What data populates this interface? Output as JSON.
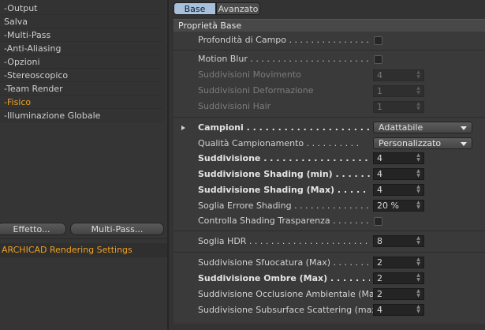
{
  "nav": {
    "items": [
      {
        "label": "Output",
        "prefix": "-",
        "active": false
      },
      {
        "label": "Salva",
        "prefix": "",
        "active": false
      },
      {
        "label": "Multi-Pass",
        "prefix": "-",
        "active": false
      },
      {
        "label": "Anti-Aliasing",
        "prefix": "-",
        "active": false
      },
      {
        "label": "Opzioni",
        "prefix": "-",
        "active": false
      },
      {
        "label": "Stereoscopico",
        "prefix": "-",
        "active": false
      },
      {
        "label": "Team Render",
        "prefix": "-",
        "active": false
      },
      {
        "label": "Fisico",
        "prefix": "-",
        "active": true
      },
      {
        "label": "Illuminazione Globale",
        "prefix": "-",
        "active": false
      }
    ],
    "effect_button": "Effetto...",
    "multipass_button": "Multi-Pass...",
    "renderer_label": "ARCHICAD Rendering Settings"
  },
  "tabs": {
    "base": "Base",
    "advanced": "Avanzato"
  },
  "group_title": "Proprietà Base",
  "rows": {
    "profondita": {
      "label": "Profondità di Campo"
    },
    "motion_blur": {
      "label": "Motion Blur"
    },
    "sudd_movimento": {
      "label": "Suddivisioni Movimento",
      "value": "4"
    },
    "sudd_deformazione": {
      "label": "Suddivisioni Deformazione",
      "value": "1"
    },
    "sudd_hair": {
      "label": "Suddivisioni Hair",
      "value": "1"
    },
    "campioni": {
      "label": "Campioni",
      "value": "Adattabile"
    },
    "qualita": {
      "label": "Qualità Campionamento",
      "value": "Personalizzato"
    },
    "suddivisione": {
      "label": "Suddivisione",
      "value": "4"
    },
    "sudd_shading_min": {
      "label": "Suddivisione Shading (min)",
      "value": "4"
    },
    "sudd_shading_max": {
      "label": "Suddivisione Shading (Max)",
      "value": "4"
    },
    "soglia_errore": {
      "label": "Soglia Errore Shading",
      "value": "20 %"
    },
    "controlla_trasparenza": {
      "label": "Controlla Shading Trasparenza"
    },
    "soglia_hdr": {
      "label": "Soglia HDR",
      "value": "8"
    },
    "sudd_sfuocatura": {
      "label": "Suddivisione Sfuocatura (Max)",
      "value": "2"
    },
    "sudd_ombre": {
      "label": "Suddivisione Ombre (Max)",
      "value": "2"
    },
    "sudd_occlusione": {
      "label": "Suddivisione Occlusione Ambientale (Max)",
      "value": "2"
    },
    "sudd_subsurface": {
      "label": "Suddivisione Subsurface Scattering (max)",
      "value": "4"
    }
  }
}
